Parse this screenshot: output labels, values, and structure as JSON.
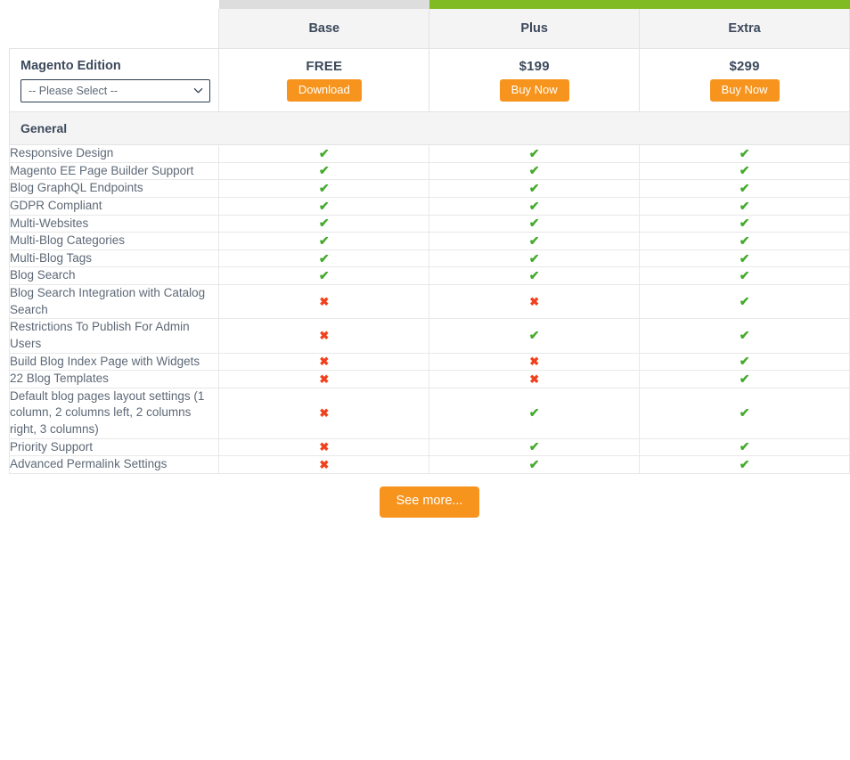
{
  "edition": {
    "label": "Magento Edition",
    "selected": "-- Please Select --",
    "options": [
      "-- Please Select --"
    ],
    "chevron_icon": "chevron-down-icon"
  },
  "plans": [
    {
      "name": "Base",
      "price": "FREE",
      "cta": "Download",
      "accent": "#dddddd",
      "highlight": false
    },
    {
      "name": "Plus",
      "price": "$199",
      "cta": "Buy Now",
      "accent": "#80bb23",
      "highlight": true
    },
    {
      "name": "Extra",
      "price": "$299",
      "cta": "Buy Now",
      "accent": "#80bb23",
      "highlight": true
    }
  ],
  "group": {
    "title": "General"
  },
  "marks": {
    "yes": "✔",
    "no": "✖"
  },
  "colors": {
    "accent_green": "#80bb23",
    "accent_gray": "#dddddd",
    "button_orange": "#f7941e",
    "check_green": "#44ab2c",
    "cross_red": "#f1401c",
    "header_bg": "#f4f4f4",
    "border": "#e8e8e8",
    "text": "#5e6977",
    "heading_text": "#3d4a5c"
  },
  "features": [
    {
      "name": "Responsive Design",
      "base": true,
      "plus": true,
      "extra": true
    },
    {
      "name": "Magento EE Page Builder Support",
      "base": true,
      "plus": true,
      "extra": true
    },
    {
      "name": "Blog GraphQL Endpoints",
      "base": true,
      "plus": true,
      "extra": true
    },
    {
      "name": "GDPR Compliant",
      "base": true,
      "plus": true,
      "extra": true
    },
    {
      "name": "Multi-Websites",
      "base": true,
      "plus": true,
      "extra": true
    },
    {
      "name": "Multi-Blog Categories",
      "base": true,
      "plus": true,
      "extra": true
    },
    {
      "name": "Multi-Blog Tags",
      "base": true,
      "plus": true,
      "extra": true
    },
    {
      "name": "Blog Search",
      "base": true,
      "plus": true,
      "extra": true
    },
    {
      "name": "Blog Search Integration with Catalog Search",
      "base": false,
      "plus": false,
      "extra": true
    },
    {
      "name": "Restrictions To Publish For Admin Users",
      "base": false,
      "plus": true,
      "extra": true
    },
    {
      "name": "Build Blog Index Page with Widgets",
      "base": false,
      "plus": false,
      "extra": true
    },
    {
      "name": "22 Blog Templates",
      "base": false,
      "plus": false,
      "extra": true
    },
    {
      "name": "Default blog pages layout settings (1 column, 2 columns left, 2 columns right, 3 columns)",
      "base": false,
      "plus": true,
      "extra": true
    },
    {
      "name": "Priority Support",
      "base": false,
      "plus": true,
      "extra": true
    },
    {
      "name": "Advanced Permalink Settings",
      "base": false,
      "plus": true,
      "extra": true
    }
  ],
  "footer": {
    "see_more": "See more..."
  }
}
